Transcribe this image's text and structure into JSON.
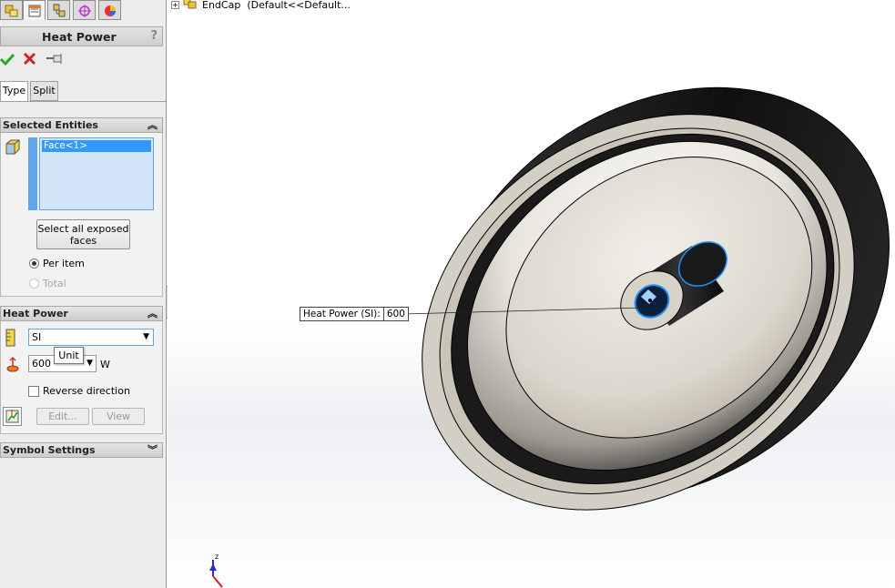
{
  "feature_tree": {
    "part_label": "EndCap",
    "config": "(Default<<Default..."
  },
  "property_manager": {
    "title": "Heat Power",
    "help": "?",
    "tabs": [
      {
        "label": "Type"
      },
      {
        "label": "Split"
      }
    ],
    "selected_entities": {
      "header": "Selected Entities",
      "items": [
        "Face<1>"
      ],
      "select_all_line1": "Select all exposed",
      "select_all_line2": "faces",
      "options": [
        {
          "label": "Per item",
          "selected": true
        },
        {
          "label": "Total",
          "selected": false,
          "disabled": true
        }
      ]
    },
    "heat_power": {
      "header": "Heat Power",
      "unit_value": "SI",
      "tooltip": "Unit",
      "value": "600",
      "unit_suffix": "W",
      "reverse_label": "Reverse direction",
      "reverse_checked": false,
      "edit_label": "Edit...",
      "view_label": "View"
    },
    "symbol_settings": {
      "header": "Symbol Settings"
    }
  },
  "callout": {
    "label": "Heat Power (SI):",
    "value": "600"
  },
  "colors": {
    "accent": "#3399ff",
    "selection_box": "#d2e6f8",
    "highlight_edge": "#1e90ff"
  }
}
